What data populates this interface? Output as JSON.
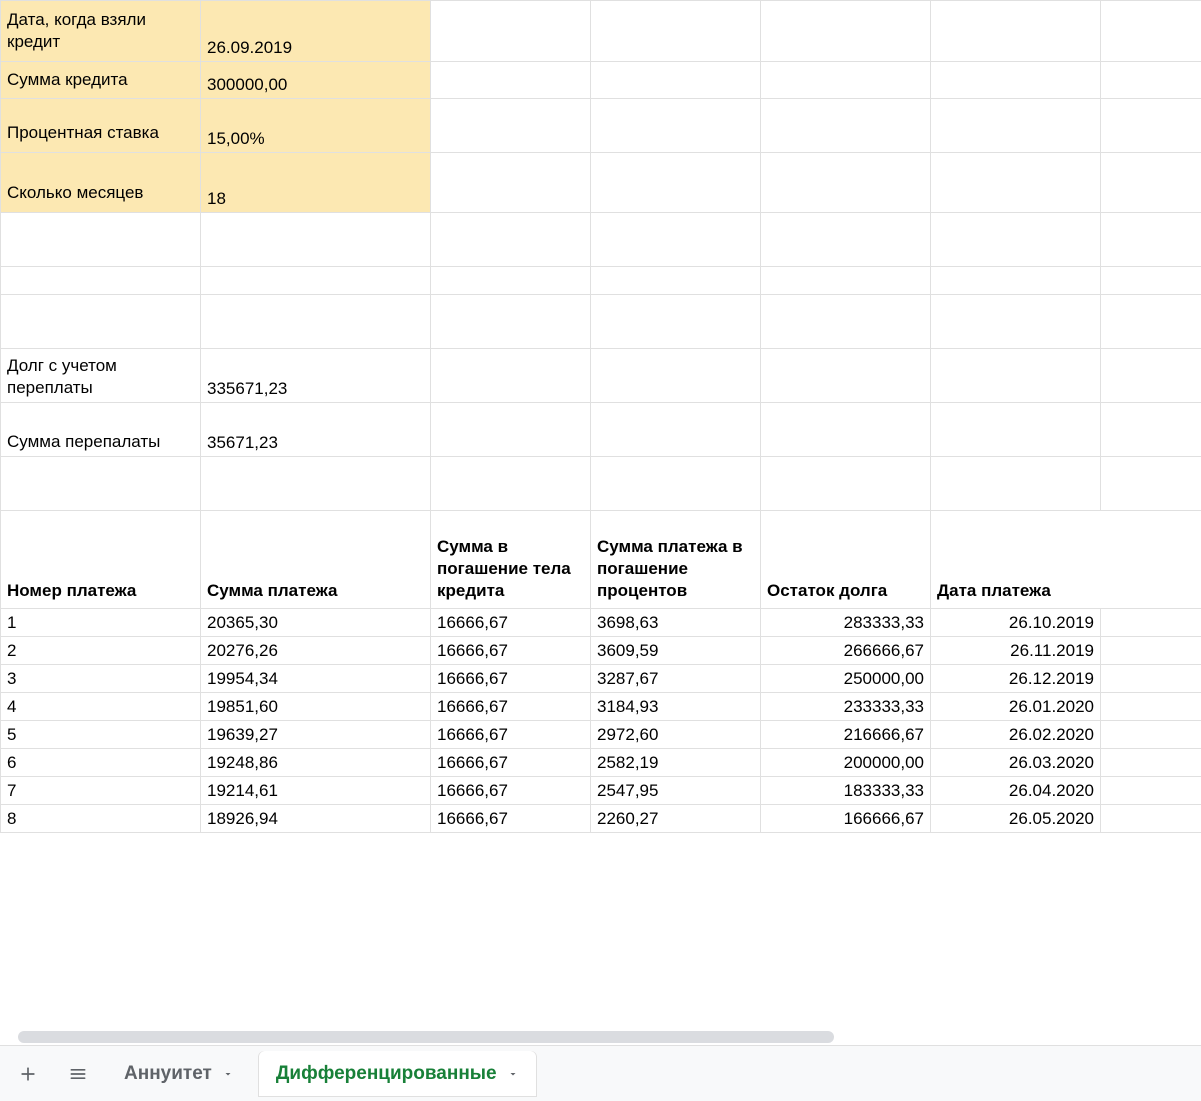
{
  "params": {
    "date_label": "Дата, когда взяли кредит",
    "date_value": "26.09.2019",
    "sum_label": "Сумма кредита",
    "sum_value": "300000,00",
    "rate_label": "Процентная ставка",
    "rate_value": "15,00%",
    "months_label": "Сколько месяцев",
    "months_value": "18"
  },
  "summary": {
    "debt_label": "Долг с учетом переплаты",
    "debt_value": "335671,23",
    "overpay_label": "Сумма перепалаты",
    "overpay_value": "35671,23"
  },
  "headers": {
    "num": "Номер платежа",
    "payment": "Сумма платежа",
    "principal": "Сумма в погашение тела кредита",
    "interest": "Сумма платежа в погашение процентов",
    "balance": "Остаток долга",
    "pdate": "Дата платежа"
  },
  "rows": [
    {
      "num": "1",
      "payment": "20365,30",
      "principal": "16666,67",
      "interest": "3698,63",
      "balance": "283333,33",
      "pdate": "26.10.2019"
    },
    {
      "num": "2",
      "payment": "20276,26",
      "principal": "16666,67",
      "interest": "3609,59",
      "balance": "266666,67",
      "pdate": "26.11.2019"
    },
    {
      "num": "3",
      "payment": "19954,34",
      "principal": "16666,67",
      "interest": "3287,67",
      "balance": "250000,00",
      "pdate": "26.12.2019"
    },
    {
      "num": "4",
      "payment": "19851,60",
      "principal": "16666,67",
      "interest": "3184,93",
      "balance": "233333,33",
      "pdate": "26.01.2020"
    },
    {
      "num": "5",
      "payment": "19639,27",
      "principal": "16666,67",
      "interest": "2972,60",
      "balance": "216666,67",
      "pdate": "26.02.2020"
    },
    {
      "num": "6",
      "payment": "19248,86",
      "principal": "16666,67",
      "interest": "2582,19",
      "balance": "200000,00",
      "pdate": "26.03.2020"
    },
    {
      "num": "7",
      "payment": "19214,61",
      "principal": "16666,67",
      "interest": "2547,95",
      "balance": "183333,33",
      "pdate": "26.04.2020"
    },
    {
      "num": "8",
      "payment": "18926,94",
      "principal": "16666,67",
      "interest": "2260,27",
      "balance": "166666,67",
      "pdate": "26.05.2020"
    }
  ],
  "tabs": {
    "annuity": "Аннуитет",
    "differentiated": "Дифференцированные"
  }
}
